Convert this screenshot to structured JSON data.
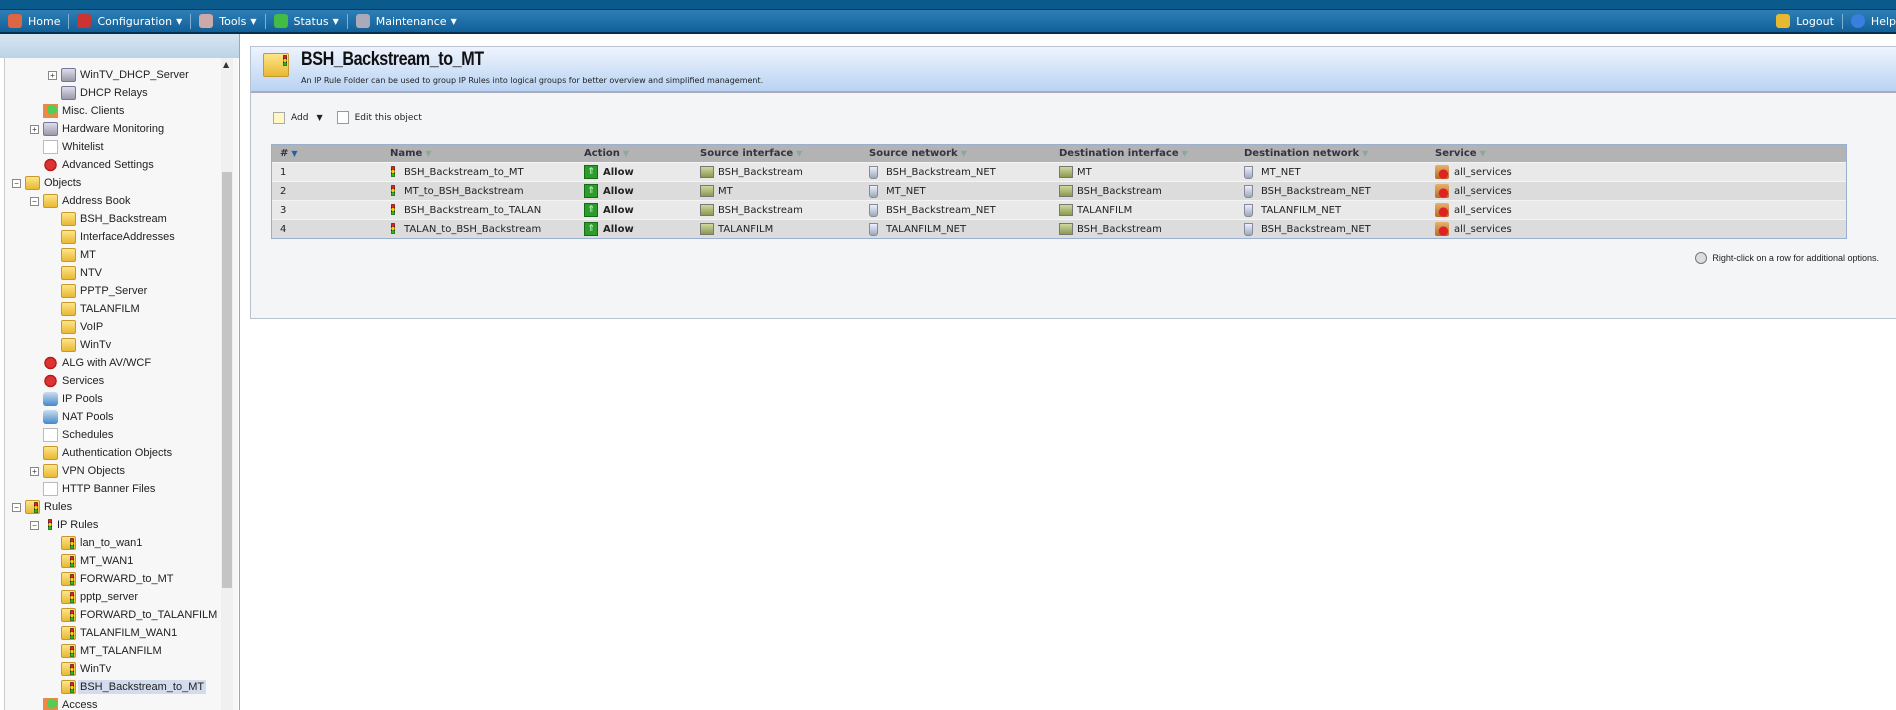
{
  "nav": {
    "left": [
      {
        "label": "Home",
        "icon": "home-icon",
        "color": "#d64"
      },
      {
        "label": "Configuration",
        "icon": "configuration-icon",
        "color": "#c33",
        "dropdown": true
      },
      {
        "label": "Tools",
        "icon": "tools-icon",
        "color": "#caa",
        "dropdown": true
      },
      {
        "label": "Status",
        "icon": "status-icon",
        "color": "#4b4",
        "dropdown": true
      },
      {
        "label": "Maintenance",
        "icon": "maintenance-icon",
        "color": "#aab",
        "dropdown": true
      }
    ],
    "logout": "Logout",
    "help": "Help"
  },
  "tree": [
    {
      "label": "WinTV_DHCP_Server",
      "level": 2,
      "icon": "server",
      "exp": "+"
    },
    {
      "label": "DHCP Relays",
      "level": 2,
      "icon": "server"
    },
    {
      "label": "Misc. Clients",
      "level": 1,
      "icon": "misc"
    },
    {
      "label": "Hardware Monitoring",
      "level": 1,
      "icon": "server",
      "exp": "+"
    },
    {
      "label": "Whitelist",
      "level": 1,
      "icon": "doc"
    },
    {
      "label": "Advanced Settings",
      "level": 1,
      "icon": "gear"
    },
    {
      "label": "Objects",
      "level": 0,
      "icon": "folder",
      "exp": "-"
    },
    {
      "label": "Address Book",
      "level": 1,
      "icon": "folder",
      "exp": "-"
    },
    {
      "label": "BSH_Backstream",
      "level": 2,
      "icon": "folder"
    },
    {
      "label": "InterfaceAddresses",
      "level": 2,
      "icon": "folder"
    },
    {
      "label": "MT",
      "level": 2,
      "icon": "folder"
    },
    {
      "label": "NTV",
      "level": 2,
      "icon": "folder"
    },
    {
      "label": "PPTP_Server",
      "level": 2,
      "icon": "folder"
    },
    {
      "label": "TALANFILM",
      "level": 2,
      "icon": "folder"
    },
    {
      "label": "VoIP",
      "level": 2,
      "icon": "folder"
    },
    {
      "label": "WinTv",
      "level": 2,
      "icon": "folder"
    },
    {
      "label": "ALG with AV/WCF",
      "level": 1,
      "icon": "gear"
    },
    {
      "label": "Services",
      "level": 1,
      "icon": "gear"
    },
    {
      "label": "IP Pools",
      "level": 1,
      "icon": "net"
    },
    {
      "label": "NAT Pools",
      "level": 1,
      "icon": "net"
    },
    {
      "label": "Schedules",
      "level": 1,
      "icon": "doc"
    },
    {
      "label": "Authentication Objects",
      "level": 1,
      "icon": "folder"
    },
    {
      "label": "VPN Objects",
      "level": 1,
      "icon": "folder",
      "exp": "+"
    },
    {
      "label": "HTTP Banner Files",
      "level": 1,
      "icon": "doc"
    },
    {
      "label": "Rules",
      "level": 0,
      "icon": "rule",
      "exp": "-"
    },
    {
      "label": "IP Rules",
      "level": 1,
      "icon": "light",
      "exp": "-"
    },
    {
      "label": "lan_to_wan1",
      "level": 2,
      "icon": "rule"
    },
    {
      "label": "MT_WAN1",
      "level": 2,
      "icon": "rule"
    },
    {
      "label": "FORWARD_to_MT",
      "level": 2,
      "icon": "rule"
    },
    {
      "label": "pptp_server",
      "level": 2,
      "icon": "rule"
    },
    {
      "label": "FORWARD_to_TALANFILM",
      "level": 2,
      "icon": "rule"
    },
    {
      "label": "TALANFILM_WAN1",
      "level": 2,
      "icon": "rule"
    },
    {
      "label": "MT_TALANFILM",
      "level": 2,
      "icon": "rule"
    },
    {
      "label": "WinTv",
      "level": 2,
      "icon": "rule"
    },
    {
      "label": "BSH_Backstream_to_MT",
      "level": 2,
      "icon": "rule",
      "selected": true
    },
    {
      "label": "Access",
      "level": 1,
      "icon": "misc"
    }
  ],
  "panel": {
    "title": "BSH_Backstream_to_MT",
    "description": "An IP Rule Folder can be used to group IP Rules into logical groups for better overview and simplified management.",
    "add_label": "Add",
    "edit_label": "Edit this object",
    "hint": "Right-click on a row for additional options."
  },
  "table": {
    "columns": [
      "#",
      "Name",
      "Action",
      "Source interface",
      "Source network",
      "Destination interface",
      "Destination network",
      "Service"
    ],
    "rows": [
      {
        "num": "1",
        "name": "BSH_Backstream_to_MT",
        "action": "Allow",
        "src_if": "BSH_Backstream",
        "src_net": "BSH_Backstream_NET",
        "dst_if": "MT",
        "dst_net": "MT_NET",
        "service": "all_services"
      },
      {
        "num": "2",
        "name": "MT_to_BSH_Backstream",
        "action": "Allow",
        "src_if": "MT",
        "src_net": "MT_NET",
        "dst_if": "BSH_Backstream",
        "dst_net": "BSH_Backstream_NET",
        "service": "all_services"
      },
      {
        "num": "3",
        "name": "BSH_Backstream_to_TALAN",
        "action": "Allow",
        "src_if": "BSH_Backstream",
        "src_net": "BSH_Backstream_NET",
        "dst_if": "TALANFILM",
        "dst_net": "TALANFILM_NET",
        "service": "all_services"
      },
      {
        "num": "4",
        "name": "TALAN_to_BSH_Backstream",
        "action": "Allow",
        "src_if": "TALANFILM",
        "src_net": "TALANFILM_NET",
        "dst_if": "BSH_Backstream",
        "dst_net": "BSH_Backstream_NET",
        "service": "all_services"
      }
    ]
  }
}
